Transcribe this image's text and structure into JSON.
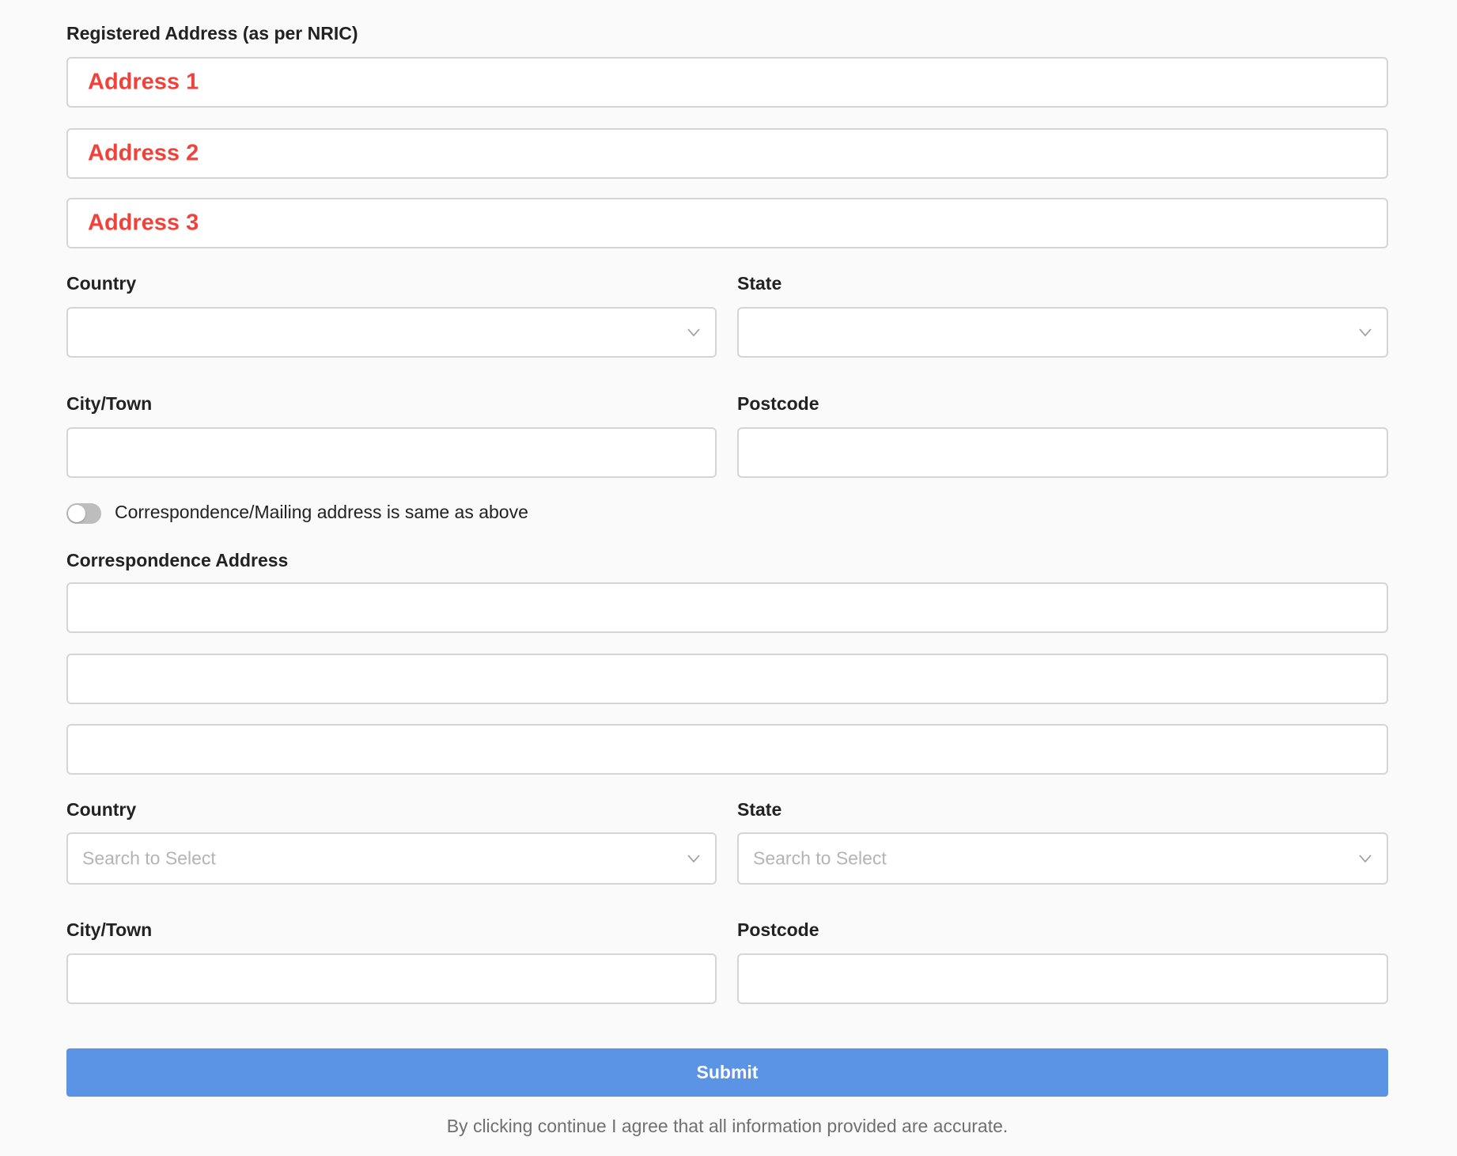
{
  "registered": {
    "section_label": "Registered Address (as per NRIC)",
    "address1_label": "Address 1",
    "address2_label": "Address 2",
    "address3_label": "Address 3",
    "country_label": "Country",
    "state_label": "State",
    "city_label": "City/Town",
    "postcode_label": "Postcode",
    "country_value": "",
    "state_value": ""
  },
  "toggle": {
    "label": "Correspondence/Mailing address is same as above",
    "checked": false
  },
  "correspondence": {
    "section_label": "Correspondence Address",
    "country_label": "Country",
    "state_label": "State",
    "city_label": "City/Town",
    "postcode_label": "Postcode",
    "country_placeholder": "Search to Select",
    "state_placeholder": "Search to Select"
  },
  "actions": {
    "submit_label": "Submit",
    "disclaimer": "By clicking continue I agree that all information provided are accurate."
  },
  "colors": {
    "accent": "#5b94e5",
    "annotation_red": "#f0423a"
  },
  "icons": {
    "dropdown": "chevron-down-icon"
  }
}
